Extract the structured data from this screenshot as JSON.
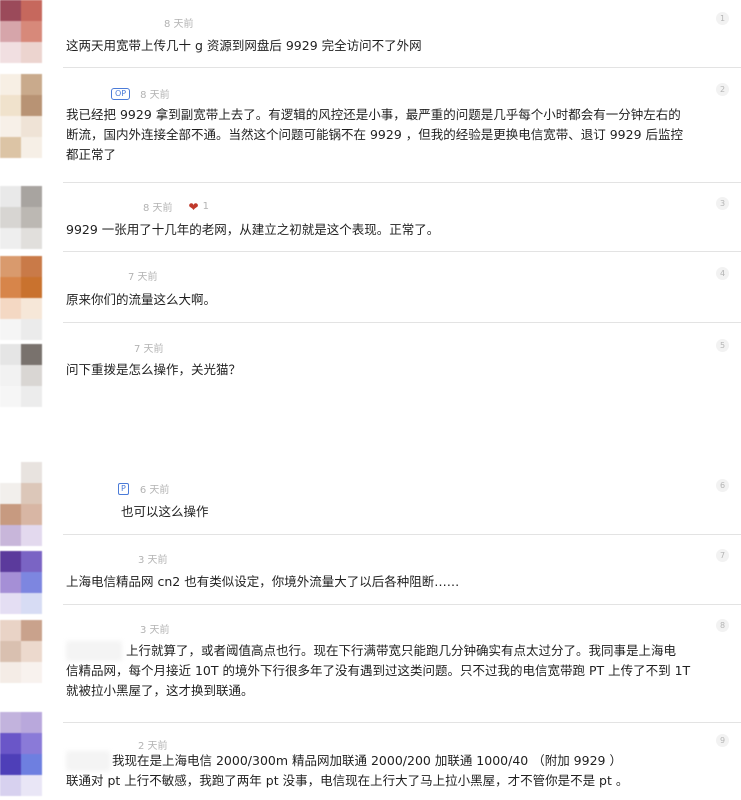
{
  "replies": [
    {
      "time": "8 天前",
      "floor": "1",
      "content": [
        "这两天用宽带上传几十 g 资源到网盘后 9929 完全访问不了外网"
      ]
    },
    {
      "time": "8 天前",
      "badge": "OP",
      "floor": "2",
      "content": [
        "我已经把 9929 拿到副宽带上去了。有逻辑的风控还是小事，最严重的问题是几乎每个小时都会有一分钟左右的",
        "断流，国内外连接全部不通。当然这个问题可能锅不在 9929 ，但我的经验是更换电信宽带、退订 9929 后监控",
        "都正常了"
      ]
    },
    {
      "time": "8 天前",
      "likes": "1",
      "floor": "3",
      "content": [
        "9929 一张用了十几年的老网，从建立之初就是这个表现。正常了。"
      ]
    },
    {
      "time": "7 天前",
      "floor": "4",
      "content": [
        "原来你们的流量这么大啊。"
      ]
    },
    {
      "time": "7 天前",
      "floor": "5",
      "content": [
        "问下重拨是怎么操作，关光猫？"
      ]
    },
    {
      "time": "6 天前",
      "badge": "P",
      "floor": "6",
      "content": [
        "也可以这么操作"
      ]
    },
    {
      "time": "3 天前",
      "floor": "7",
      "content": [
        "上海电信精品网 cn2 也有类似设定，你境外流量大了以后各种阻断……"
      ]
    },
    {
      "time": "3 天前",
      "floor": "8",
      "content": [
        "上行就算了，或者阈值高点也行。现在下行满带宽只能跑几分钟确实有点太过分了。我同事是上海电",
        "信精品网，每个月接近 10T 的境外下行很多年了没有遇到过这类问题。只不过我的电信宽带跑 PT 上传了不到 1T",
        "就被拉小黑屋了，这才换到联通。"
      ]
    },
    {
      "time": "2 天前",
      "floor": "9",
      "content": [
        "我现在是上海电信 2000/300m 精品网加联通 2000/200 加联通 1000/40 （附加 9929 ）",
        "联通对 pt 上行不敏感，我跑了两年 pt 没事，电信现在上行大了马上拉小黑屋，才不管你是不是 pt 。"
      ]
    }
  ]
}
